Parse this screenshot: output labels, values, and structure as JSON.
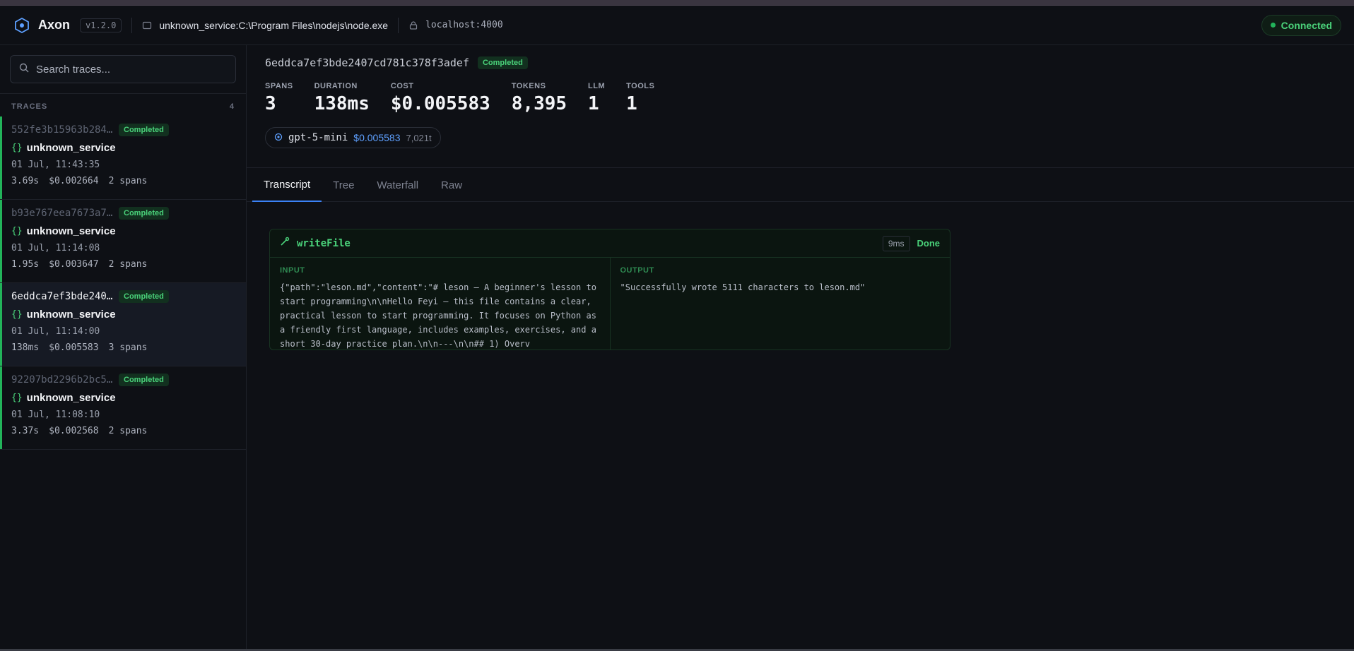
{
  "header": {
    "brand": "Axon",
    "version": "v1.2.0",
    "service_path": "unknown_service:C:\\Program Files\\nodejs\\node.exe",
    "host": "localhost:4000",
    "status": "Connected"
  },
  "sidebar": {
    "search_placeholder": "Search traces...",
    "traces_label": "TRACES",
    "traces_count": "4",
    "traces": [
      {
        "id": "552fe3b15963b284…",
        "status": "Completed",
        "service": "unknown_service",
        "time": "01 Jul, 11:43:35",
        "duration": "3.69s",
        "cost": "$0.002664",
        "spans": "2 spans"
      },
      {
        "id": "b93e767eea7673a7…",
        "status": "Completed",
        "service": "unknown_service",
        "time": "01 Jul, 11:14:08",
        "duration": "1.95s",
        "cost": "$0.003647",
        "spans": "2 spans"
      },
      {
        "id": "6eddca7ef3bde240…",
        "status": "Completed",
        "service": "unknown_service",
        "time": "01 Jul, 11:14:00",
        "duration": "138ms",
        "cost": "$0.005583",
        "spans": "3 spans"
      },
      {
        "id": "92207bd2296b2bc5…",
        "status": "Completed",
        "service": "unknown_service",
        "time": "01 Jul, 11:08:10",
        "duration": "3.37s",
        "cost": "$0.002568",
        "spans": "2 spans"
      }
    ]
  },
  "detail": {
    "trace_id": "6eddca7ef3bde2407cd781c378f3adef",
    "status": "Completed",
    "stats": {
      "spans_label": "SPANS",
      "spans": "3",
      "duration_label": "DURATION",
      "duration": "138ms",
      "cost_label": "COST",
      "cost": "$0.005583",
      "tokens_label": "TOKENS",
      "tokens": "8,395",
      "llm_label": "LLM",
      "llm": "1",
      "tools_label": "TOOLS",
      "tools": "1"
    },
    "model": {
      "name": "gpt-5-mini",
      "cost": "$0.005583",
      "tokens": "7,021t"
    },
    "tabs": [
      "Transcript",
      "Tree",
      "Waterfall",
      "Raw"
    ],
    "tool": {
      "name": "writeFile",
      "duration": "9ms",
      "status": "Done",
      "input_label": "INPUT",
      "input": "{\"path\":\"leson.md\",\"content\":\"# leson — A beginner's lesson to start programming\\n\\nHello Feyi — this file contains a clear, practical lesson to start programming. It focuses on Python as a friendly first language, includes examples, exercises, and a short 30-day practice plan.\\n\\n---\\n\\n## 1) Overv",
      "output_label": "OUTPUT",
      "output": "\"Successfully wrote 5111 characters to leson.md\""
    }
  },
  "colors": {
    "accent": "#3b82f6",
    "success": "#4ad27a",
    "background": "#0e1015"
  }
}
